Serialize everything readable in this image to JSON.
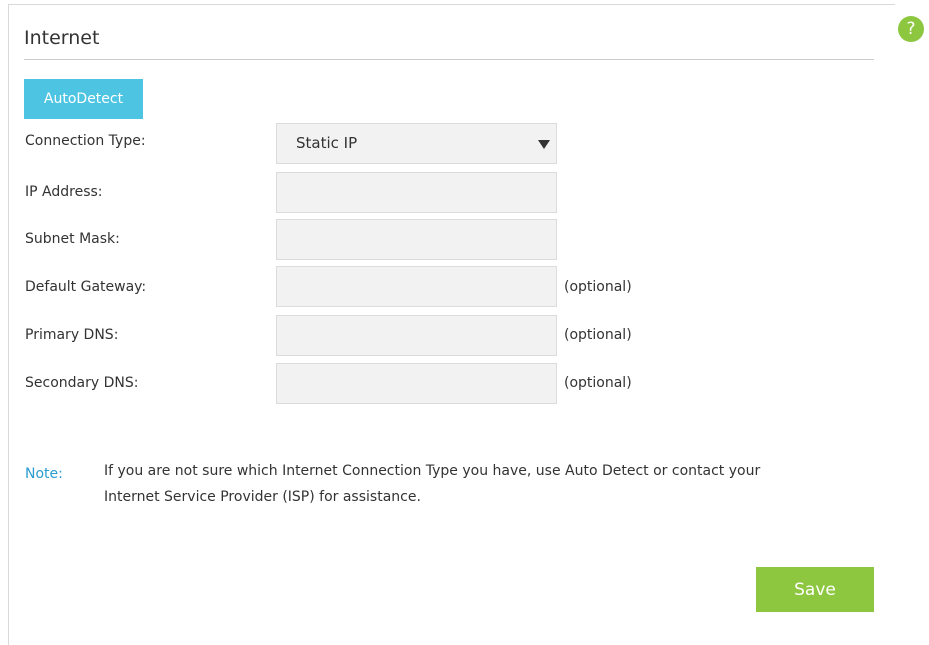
{
  "header": {
    "title": "Internet",
    "help_glyph": "?"
  },
  "toolbar": {
    "autodetect_label": "AutoDetect"
  },
  "form": {
    "connection_type": {
      "label": "Connection Type:",
      "selected": "Static IP"
    },
    "ip_address": {
      "label": "IP Address:",
      "value": ""
    },
    "subnet_mask": {
      "label": "Subnet Mask:",
      "value": ""
    },
    "default_gateway": {
      "label": "Default Gateway:",
      "value": "",
      "hint": "(optional)"
    },
    "primary_dns": {
      "label": "Primary DNS:",
      "value": "",
      "hint": "(optional)"
    },
    "secondary_dns": {
      "label": "Secondary DNS:",
      "value": "",
      "hint": "(optional)"
    }
  },
  "note": {
    "label": "Note:",
    "text_line1": "If you are not sure which Internet Connection Type you have, use Auto Detect or contact your",
    "text_line2": "Internet Service Provider (ISP) for assistance."
  },
  "footer": {
    "save_label": "Save"
  },
  "colors": {
    "accent_blue": "#4ec4e3",
    "accent_green": "#8dc63f",
    "note_blue": "#2b9bd0",
    "field_bg": "#f2f2f2"
  },
  "icons": {
    "help": "help-icon",
    "dropdown": "chevron-down-icon"
  }
}
